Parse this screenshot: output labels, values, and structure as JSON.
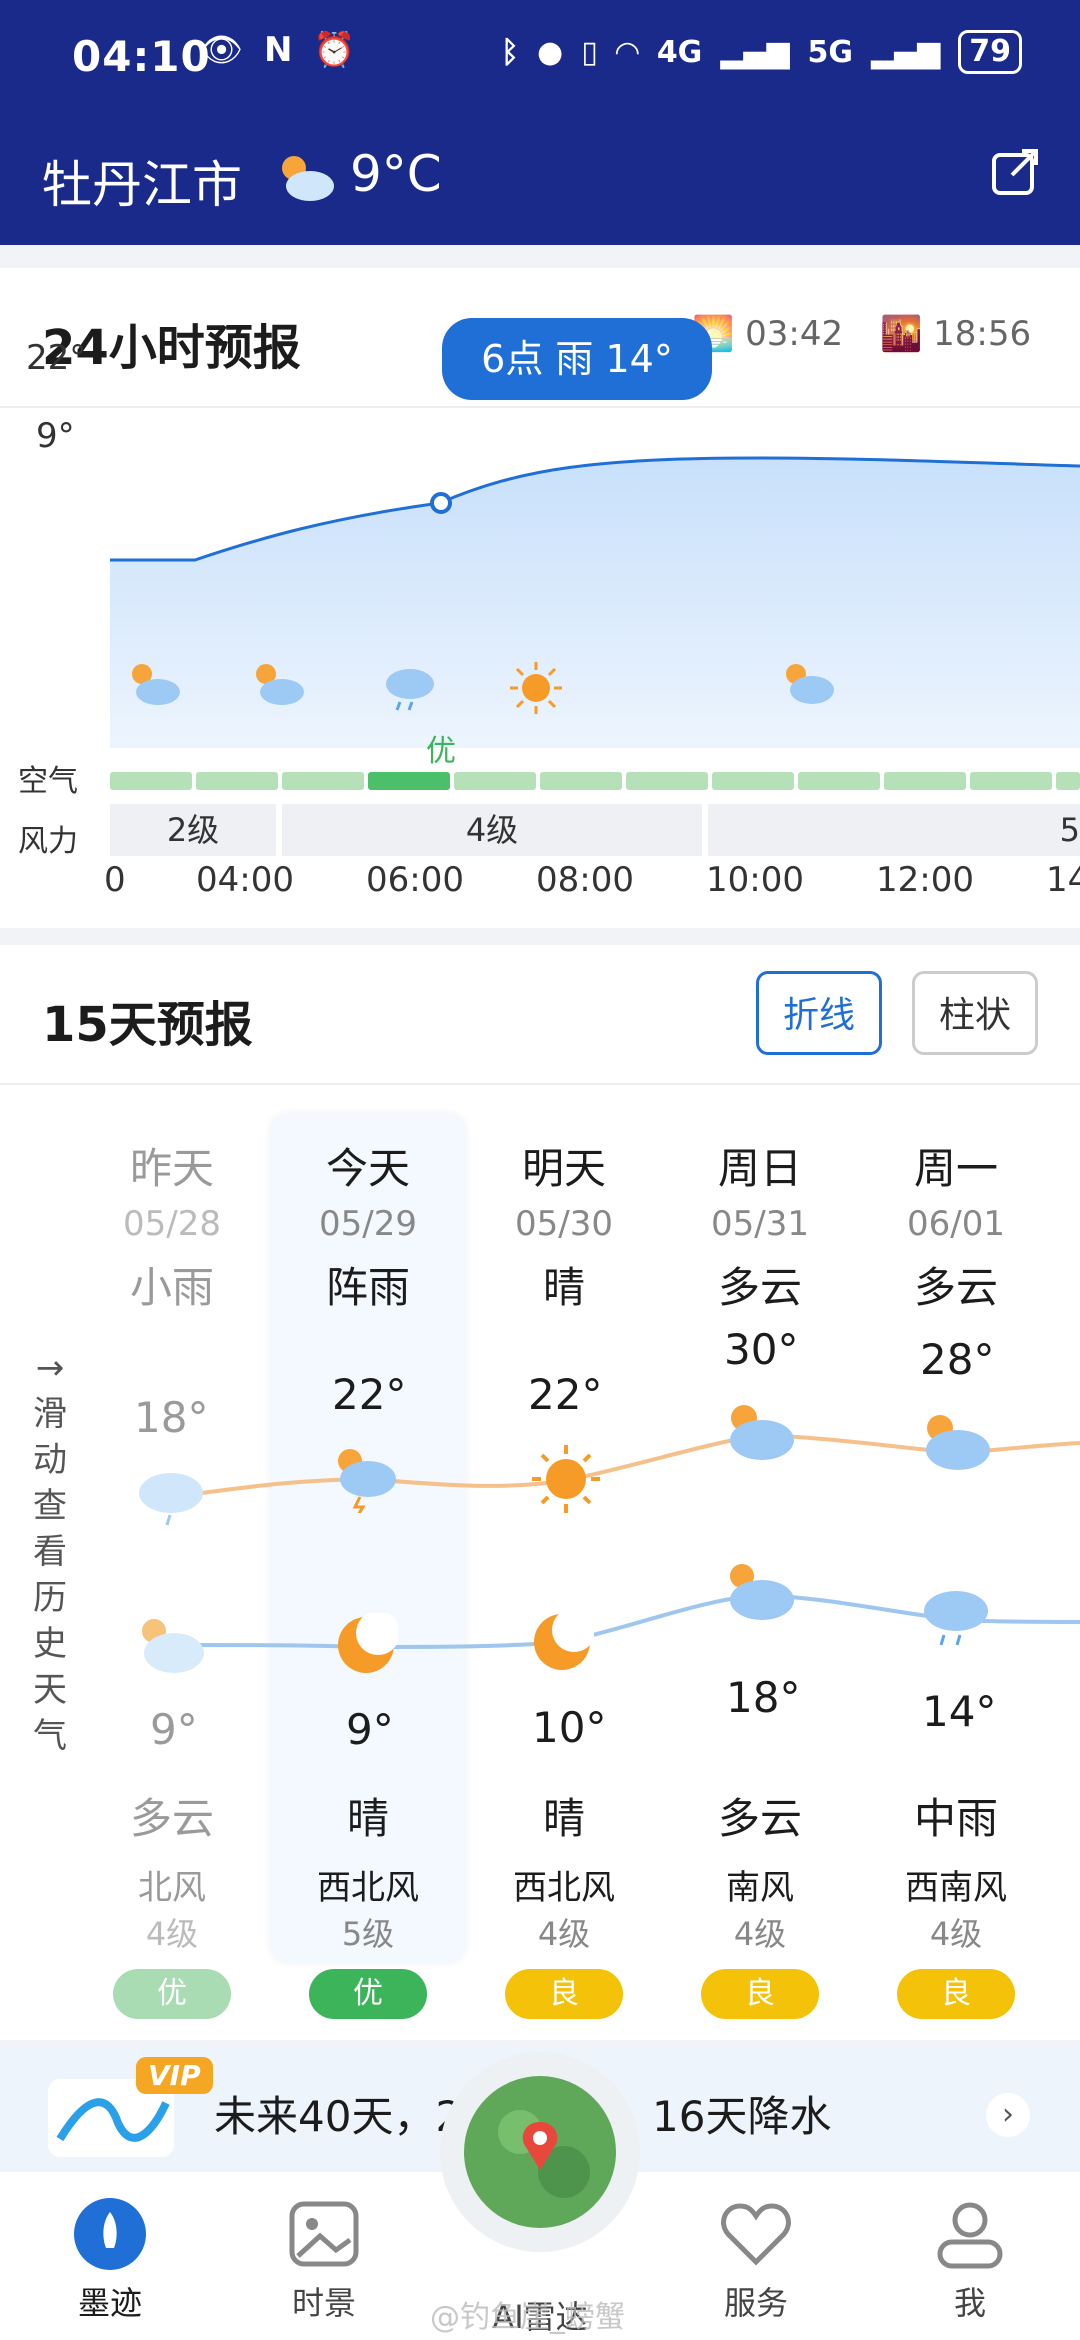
{
  "status": {
    "time": "04:10",
    "network": "4G",
    "network2": "5G",
    "battery": "79"
  },
  "header": {
    "city": "牡丹江市",
    "temp": "9°C"
  },
  "hourly": {
    "title": "24小时预报",
    "sunrise": "03:42",
    "sunset": "18:56",
    "tooltip": "6点 雨 14°",
    "y_labels": [
      "22°",
      "9°"
    ],
    "air_label": "空气",
    "wind_label": "风力",
    "aqi_marker": "优",
    "wind_levels": [
      "2级",
      "4级",
      "5"
    ],
    "times": [
      "0",
      "04:00",
      "06:00",
      "08:00",
      "10:00",
      "12:00",
      "14"
    ]
  },
  "daily": {
    "title": "15天预报",
    "tab_line": "折线",
    "tab_bar": "柱状",
    "history_hint": [
      "→",
      "滑",
      "动",
      "查",
      "看",
      "历",
      "史",
      "天",
      "气"
    ],
    "days": [
      {
        "name": "昨天",
        "date": "05/28",
        "day_cond": "小雨",
        "high": "18°",
        "low": "9°",
        "night_cond": "多云",
        "wind": "北风",
        "level": "4级",
        "aqi": "优"
      },
      {
        "name": "今天",
        "date": "05/29",
        "day_cond": "阵雨",
        "high": "22°",
        "low": "9°",
        "night_cond": "晴",
        "wind": "西北风",
        "level": "5级",
        "aqi": "优"
      },
      {
        "name": "明天",
        "date": "05/30",
        "day_cond": "晴",
        "high": "22°",
        "low": "10°",
        "night_cond": "晴",
        "wind": "西北风",
        "level": "4级",
        "aqi": "良"
      },
      {
        "name": "周日",
        "date": "05/31",
        "day_cond": "多云",
        "high": "30°",
        "low": "18°",
        "night_cond": "多云",
        "wind": "南风",
        "level": "4级",
        "aqi": "良"
      },
      {
        "name": "周一",
        "date": "06/01",
        "day_cond": "多云",
        "high": "28°",
        "low": "14°",
        "night_cond": "中雨",
        "wind": "西南风",
        "level": "4级",
        "aqi": "良"
      }
    ]
  },
  "banner": {
    "badge": "VIP",
    "text_left": "未来40天，2",
    "text_right": "16天降水"
  },
  "nav": {
    "items": [
      "墨迹",
      "时景",
      "AI雷达",
      "服务",
      "我"
    ],
    "watermark": "@钓鱼崖_螃蟹"
  },
  "colors": {
    "header_bg": "#1a2a8a",
    "accent": "#1f6fd6",
    "good": "#3cb55a",
    "fair": "#f5c20a"
  }
}
